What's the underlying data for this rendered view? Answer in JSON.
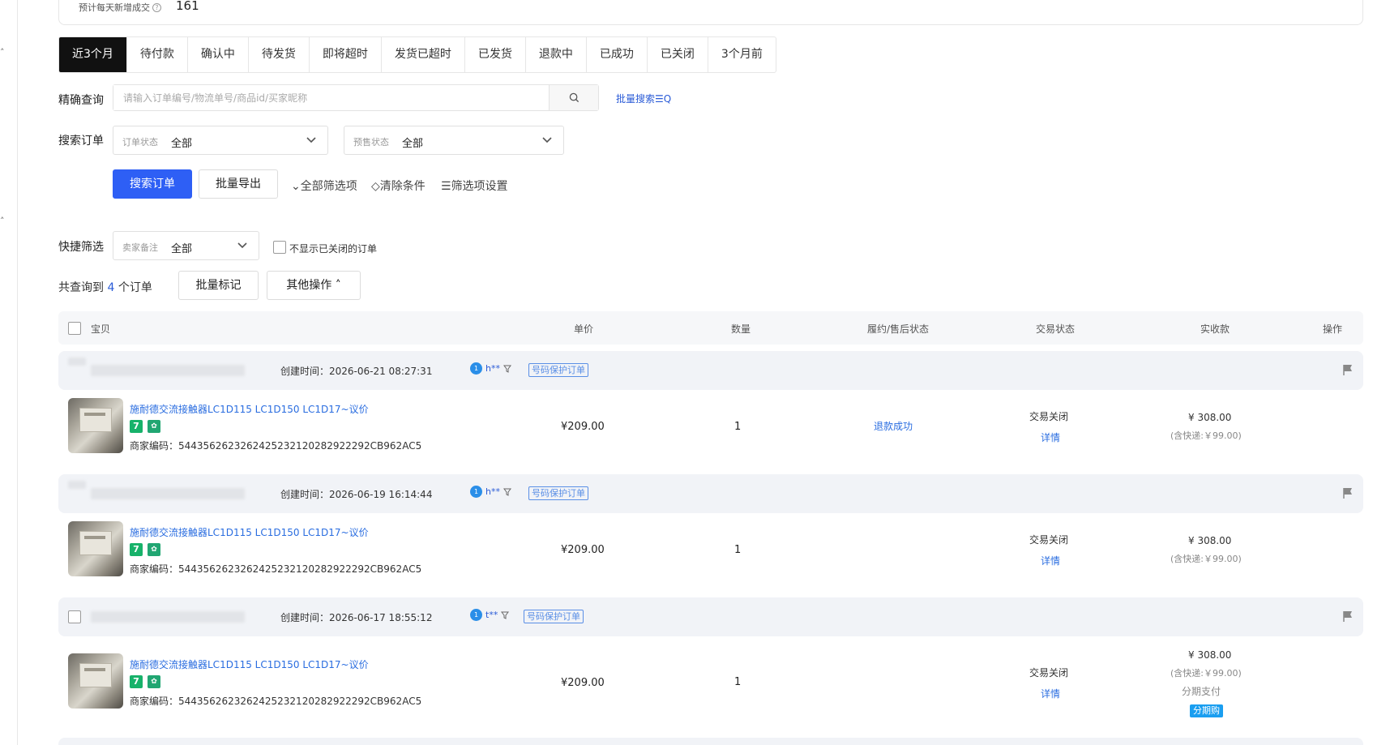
{
  "summary": {
    "label": "预计每天新增成交",
    "value": "161"
  },
  "tabs": [
    "近3个月",
    "待付款",
    "确认中",
    "待发货",
    "即将超时",
    "发货已超时",
    "已发货",
    "退款中",
    "已成功",
    "已关闭",
    "3个月前"
  ],
  "filters": {
    "precise_label": "精确查询",
    "search_placeholder": "请输入订单编号/物流单号/商品id/买家昵称",
    "batch_search": "批量搜索☰Q",
    "search_orders_label": "搜索订单",
    "order_status_prefix": "订单状态",
    "order_status_value": "全部",
    "presale_status_prefix": "预售状态",
    "presale_status_value": "全部",
    "search_button": "搜索订单",
    "export_button": "批量导出",
    "all_filters": "全部筛选项",
    "clear_conditions": "清除条件",
    "filter_settings": "筛选项设置",
    "quick_filter_label": "快捷筛选",
    "seller_note_prefix": "卖家备注",
    "seller_note_value": "全部",
    "hide_closed_label": "不显示已关闭的订单"
  },
  "results": {
    "prefix": "共查询到",
    "count": "4",
    "suffix": "个订单",
    "batch_mark": "批量标记",
    "other_ops": "其他操作 ˄"
  },
  "table_headers": {
    "item": "宝贝",
    "unit_price": "单价",
    "quantity": "数量",
    "fulfillment": "履约/售后状态",
    "trade_status": "交易状态",
    "paid": "实收款",
    "actions": "操作"
  },
  "orders": [
    {
      "created": "创建时间：2026-06-21 08:27:31",
      "buyer": "h**",
      "tag": "号码保护订单",
      "product_title": "施耐德交流接触器LC1D115 LC1D150 LC1D17~议价",
      "merchant_code": "商家编码：544356262326242523212028292229​2CB962AC5",
      "price": "¥209.00",
      "qty": "1",
      "after_sale": "退款成功",
      "trade_status": "交易关闭",
      "detail": "详情",
      "paid": "¥ 308.00",
      "shipping": "(含快递:￥99.00)"
    },
    {
      "created": "创建时间：2026-06-19 16:14:44",
      "buyer": "h**",
      "tag": "号码保护订单",
      "product_title": "施耐德交流接触器LC1D115 LC1D150 LC1D17~议价",
      "merchant_code": "商家编码：5443562623262425232120282922292CB962AC5",
      "price": "¥209.00",
      "qty": "1",
      "trade_status": "交易关闭",
      "detail": "详情",
      "paid": "¥ 308.00",
      "shipping": "(含快递:￥99.00)"
    },
    {
      "created": "创建时间：2026-06-17 18:55:12",
      "buyer": "t**",
      "tag": "号码保护订单",
      "product_title": "施耐德交流接触器LC1D115 LC1D150 LC1D17~议价",
      "merchant_code": "商家编码：5443562623262425232120282922292CB962AC5",
      "price": "¥209.00",
      "qty": "1",
      "trade_status": "交易关闭",
      "detail": "详情",
      "paid": "¥ 308.00",
      "shipping": "(含快递:￥99.00)",
      "pay_method": "分期支付",
      "pay_badge": "分期购"
    }
  ],
  "badges": {
    "seven": "7",
    "shield": "✿"
  },
  "colors": {
    "primary": "#2e5ff5",
    "link": "#2a6de0",
    "tab_active": "#111111",
    "installment": "#1a9ef0"
  }
}
